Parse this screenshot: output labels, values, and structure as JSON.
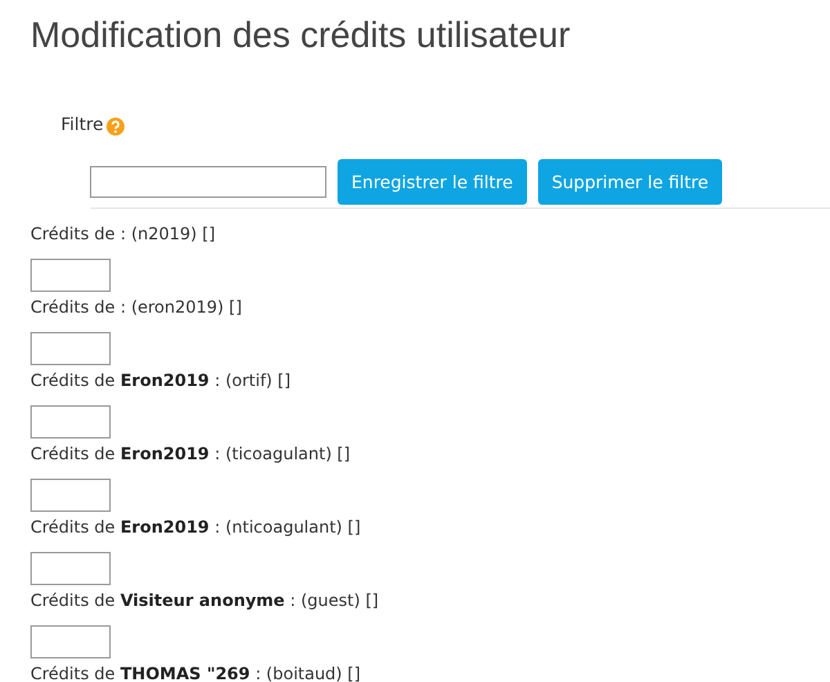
{
  "title": "Modification des crédits utilisateur",
  "filter": {
    "label": "Filtre",
    "buttons": [
      "Enregistrer le filtre",
      "Supprimer le filtre"
    ]
  },
  "credits": [
    {
      "label": "Crédits de : (n2019) []"
    },
    {
      "label": "Crédits de : (eron2019) []"
    },
    {
      "label": "Crédits de **Eron2019** : (ortif) []"
    },
    {
      "label": "Crédits de **Eron2019** : (ticoagulant) []"
    },
    {
      "label": "Crédits de **Eron2019** : (nticoagulant) []"
    },
    {
      "label": "Crédits de **Visiteur anonyme** : (guest) []"
    },
    {
      "label": "Crédits de **THOMAS \"269** : (boitaud) []"
    }
  ]
}
